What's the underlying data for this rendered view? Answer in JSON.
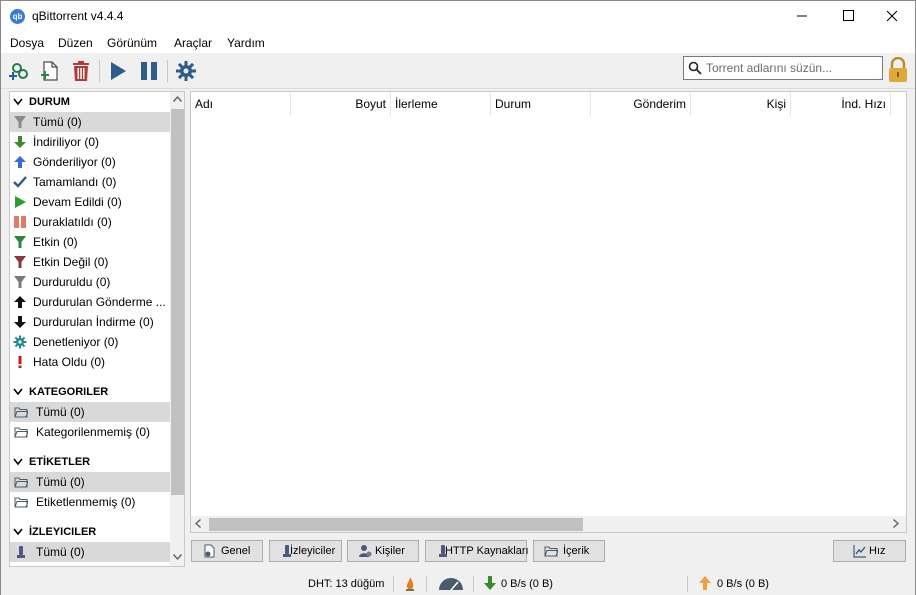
{
  "window": {
    "title": "qBittorrent v4.4.4",
    "icon_text": "qb",
    "controls": [
      "minimize-icon",
      "maximize-icon",
      "close-icon"
    ]
  },
  "menu": [
    "Dosya",
    "Düzen",
    "Görünüm",
    "Araçlar",
    "Yardım"
  ],
  "toolbar": {
    "buttons": [
      "add-torrent-link-icon",
      "add-torrent-file-icon",
      "delete-icon",
      "resume-icon",
      "pause-icon",
      "options-gear-icon"
    ],
    "search_placeholder": "Torrent adlarını süzün...",
    "lock_icon": "lock-icon"
  },
  "sidebar": {
    "status_header": "DURUM",
    "status_items": [
      {
        "label": "Tümü (0)",
        "icon": "funnel-gray-icon",
        "selected": true
      },
      {
        "label": "İndiriliyor (0)",
        "icon": "arrow-down-green-icon"
      },
      {
        "label": "Gönderiliyor (0)",
        "icon": "arrow-up-blue-icon"
      },
      {
        "label": "Tamamlandı (0)",
        "icon": "checkmark-icon"
      },
      {
        "label": "Devam Edildi (0)",
        "icon": "play-green-icon"
      },
      {
        "label": "Duraklatıldı (0)",
        "icon": "pause-red-icon"
      },
      {
        "label": "Etkin (0)",
        "icon": "funnel-green-icon"
      },
      {
        "label": "Etkin Değil (0)",
        "icon": "funnel-red-icon"
      },
      {
        "label": "Durduruldu (0)",
        "icon": "funnel-gray-icon"
      },
      {
        "label": "Durdurulan Gönderme ...",
        "icon": "arrow-up-black-icon"
      },
      {
        "label": "Durdurulan İndirme (0)",
        "icon": "arrow-down-black-icon"
      },
      {
        "label": "Denetleniyor (0)",
        "icon": "gear-teal-icon"
      },
      {
        "label": "Hata Oldu (0)",
        "icon": "exclamation-red-icon"
      }
    ],
    "categories_header": "KATEGORILER",
    "category_items": [
      {
        "label": "Tümü (0)",
        "icon": "folder-icon",
        "selected": true
      },
      {
        "label": "Kategorilenmemiş (0)",
        "icon": "folder-icon"
      }
    ],
    "tags_header": "ETİKETLER",
    "tag_items": [
      {
        "label": "Tümü (0)",
        "icon": "folder-icon",
        "selected": true
      },
      {
        "label": "Etiketlenmemiş (0)",
        "icon": "folder-icon"
      }
    ],
    "trackers_header": "İZLEYICILER",
    "tracker_items": [
      {
        "label": "Tümü (0)",
        "icon": "tracker-icon",
        "selected": true
      }
    ]
  },
  "table": {
    "columns": [
      "Adı",
      "Boyut",
      "İlerleme",
      "Durum",
      "Gönderim",
      "Kişi",
      "İnd. Hızı"
    ]
  },
  "tabs": [
    {
      "label": "Genel",
      "icon": "general-info-icon"
    },
    {
      "label": "İzleyiciler",
      "icon": "tracker-icon"
    },
    {
      "label": "Kişiler",
      "icon": "peers-icon"
    },
    {
      "label": "HTTP Kaynakları",
      "icon": "http-sources-icon"
    },
    {
      "label": "İçerik",
      "icon": "folder-icon"
    }
  ],
  "speed_button": {
    "label": "Hız",
    "icon": "speed-chart-icon"
  },
  "status": {
    "dht": "DHT: 13 düğüm",
    "download": "0 B/s (0 B)",
    "upload": "0 B/s (0 B)"
  },
  "colors": {
    "selection": "#d9d9d9",
    "download_green": "#3a8a2a",
    "upload_orange": "#e8a040",
    "accent_blue": "#3a7bd5"
  }
}
